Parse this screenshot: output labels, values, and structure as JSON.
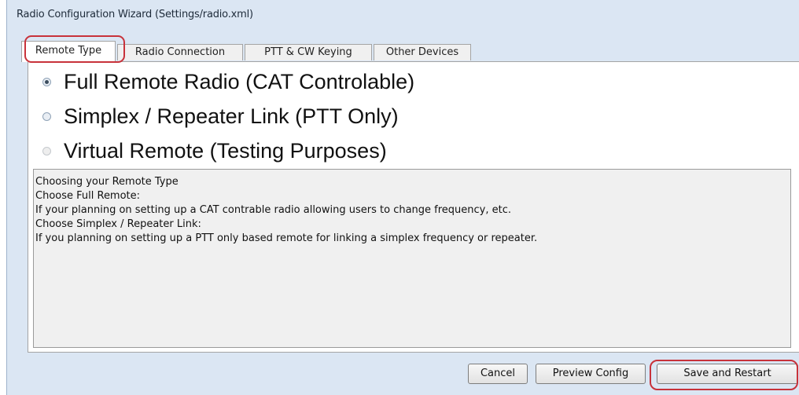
{
  "window": {
    "title": "Radio Configuration Wizard (Settings/radio.xml)"
  },
  "tabs": [
    {
      "label": "Remote Type",
      "active": true
    },
    {
      "label": "Radio Connection",
      "active": false
    },
    {
      "label": "PTT & CW Keying",
      "active": false
    },
    {
      "label": "Other Devices",
      "active": false
    }
  ],
  "remote_type": {
    "options": [
      {
        "label": "Full Remote Radio (CAT Controlable)",
        "checked": true
      },
      {
        "label": "Simplex / Repeater Link (PTT Only)",
        "checked": false
      },
      {
        "label": "Virtual Remote (Testing Purposes)",
        "checked": false,
        "disabled": true
      }
    ]
  },
  "description": {
    "lines": [
      "Choosing your Remote Type",
      "",
      "Choose Full Remote:",
      "If your planning on setting up a CAT contrable radio allowing users to change frequency, etc.",
      "",
      "Choose Simplex / Repeater Link:",
      "If you planning on setting up a PTT only based remote for linking a simplex frequency or repeater."
    ]
  },
  "buttons": {
    "cancel": "Cancel",
    "preview": "Preview Config",
    "save": "Save and Restart"
  },
  "colors": {
    "highlight": "#c8323a",
    "window_bg": "#dbe6f3"
  }
}
